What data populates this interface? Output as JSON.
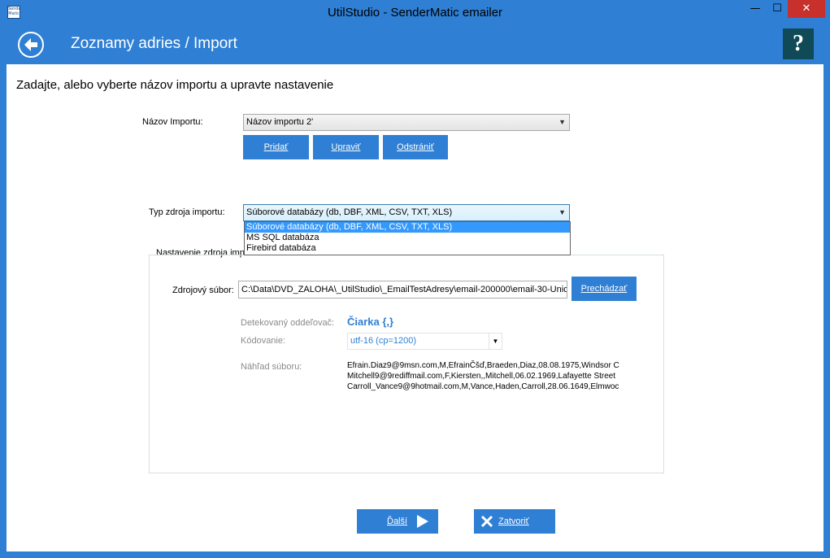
{
  "window": {
    "app_icon_text": "Sender Matic",
    "title": "UtilStudio - SenderMatic emailer",
    "minimize": "—",
    "maximize": "☐",
    "close": "✕"
  },
  "header": {
    "title": "Zoznamy adries / Import",
    "help_label": "?"
  },
  "instruction": "Zadajte, alebo vyberte názov importu a upravte nastavenie",
  "import_name": {
    "label": "Názov Importu:",
    "value": "Názov importu 2'"
  },
  "buttons": {
    "add": "Pridať",
    "edit": "Upraviť",
    "remove": "Odstrániť",
    "browse": "Prechádzať",
    "next": "Ďalší",
    "close": "Zatvoriť"
  },
  "source_type": {
    "label": "Typ zdroja importu:",
    "value": "Súborové databázy (db, DBF, XML, CSV, TXT, XLS)",
    "options": [
      "Súborové databázy (db, DBF, XML, CSV, TXT, XLS)",
      "MS SQL databáza",
      "Firebird databáza"
    ]
  },
  "source_settings": {
    "group_title": "Nastavenie zdroja importu",
    "file_label": "Zdrojový súbor:",
    "file_value": "C:\\Data\\DVD_ZALOHA\\_UtilStudio\\_EmailTestAdresy\\email-200000\\email-30-Unic",
    "separator_label": "Detekovaný oddeľovač:",
    "separator_value": "Čiarka {,}",
    "encoding_label": "Kódovanie:",
    "encoding_value": "utf-16    (cp=1200)",
    "preview_label": "Náhľad súboru:",
    "preview_lines": [
      "Efrain.Diaz9@9msn.com,M,EfrainČšď,Braeden,Diaz,08.08.1975,Windsor C",
      "Mitchell9@9rediffmail.com,F,Kiersten,,Mitchell,06.02.1969,Lafayette Street",
      "Carroll_Vance9@9hotmail.com,M,Vance,Haden,Carroll,28.06.1649,Elmwoc"
    ]
  },
  "colors": {
    "accent": "#2f7fd4",
    "help_bg": "#0f4a56",
    "close_red": "#c7302b",
    "dropdown_selected": "#3399ff"
  }
}
